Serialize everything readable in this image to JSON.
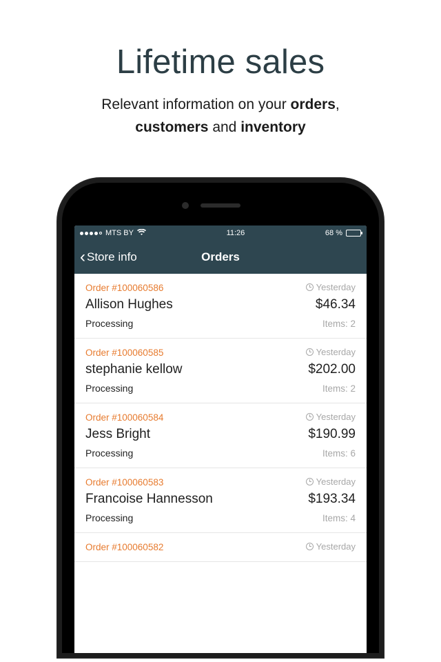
{
  "hero": {
    "title": "Lifetime sales",
    "sub_prefix": "Relevant information on your ",
    "sub_bold1": "orders",
    "sub_mid1": ", ",
    "sub_bold2": "customers",
    "sub_mid2": " and ",
    "sub_bold3": "inventory"
  },
  "statusbar": {
    "carrier": "MTS BY",
    "wifi_glyph": "􀙇",
    "time": "11:26",
    "battery_pct": "68 %"
  },
  "nav": {
    "back_label": "Store info",
    "title": "Orders"
  },
  "items_prefix": "Items: ",
  "orders": [
    {
      "num": "Order #100060586",
      "date": "Yesterday",
      "customer": "Allison Hughes",
      "amount": "$46.34",
      "status": "Processing",
      "items": "2"
    },
    {
      "num": "Order #100060585",
      "date": "Yesterday",
      "customer": "stephanie kellow",
      "amount": "$202.00",
      "status": "Processing",
      "items": "2"
    },
    {
      "num": "Order #100060584",
      "date": "Yesterday",
      "customer": "Jess Bright",
      "amount": "$190.99",
      "status": "Processing",
      "items": "6"
    },
    {
      "num": "Order #100060583",
      "date": "Yesterday",
      "customer": "Francoise Hannesson",
      "amount": "$193.34",
      "status": "Processing",
      "items": "4"
    },
    {
      "num": "Order #100060582",
      "date": "Yesterday",
      "customer": "",
      "amount": "",
      "status": "",
      "items": ""
    }
  ]
}
